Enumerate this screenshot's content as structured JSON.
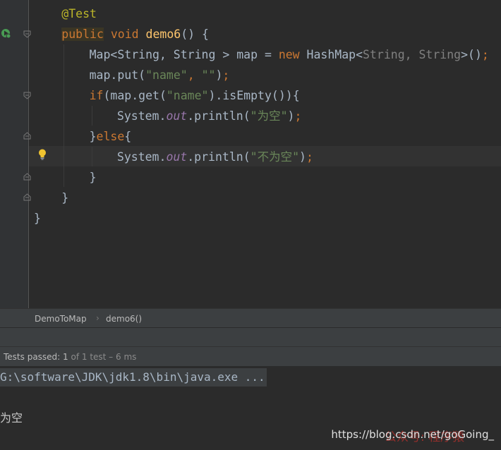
{
  "editor": {
    "code_lines": [
      {
        "indent": 10,
        "tokens": [
          {
            "t": "@Test",
            "c": "ann"
          }
        ]
      },
      {
        "indent": 10,
        "tokens": [
          {
            "t": "public",
            "c": "kw-hl"
          },
          {
            "t": " ",
            "c": ""
          },
          {
            "t": "void",
            "c": "kw"
          },
          {
            "t": " ",
            "c": ""
          },
          {
            "t": "demo6",
            "c": "fn"
          },
          {
            "t": "() {",
            "c": ""
          }
        ]
      },
      {
        "indent": 20,
        "tokens": [
          {
            "t": "Map<String, String > map = ",
            "c": ""
          },
          {
            "t": "new",
            "c": "kw"
          },
          {
            "t": " HashMap<",
            "c": ""
          },
          {
            "t": "String, String",
            "c": "gen"
          },
          {
            "t": ">()",
            "c": ""
          },
          {
            "t": ";",
            "c": "kw"
          }
        ]
      },
      {
        "indent": 20,
        "tokens": [
          {
            "t": "map.put(",
            "c": ""
          },
          {
            "t": "\"name\"",
            "c": "str"
          },
          {
            "t": ", ",
            "c": "kw"
          },
          {
            "t": "\"\"",
            "c": "str"
          },
          {
            "t": ")",
            "c": ""
          },
          {
            "t": ";",
            "c": "kw"
          }
        ]
      },
      {
        "indent": 20,
        "tokens": [
          {
            "t": "if",
            "c": "kw"
          },
          {
            "t": "(map.get(",
            "c": ""
          },
          {
            "t": "\"name\"",
            "c": "str"
          },
          {
            "t": ").isEmpty()){",
            "c": ""
          }
        ]
      },
      {
        "indent": 30,
        "tokens": [
          {
            "t": "System.",
            "c": ""
          },
          {
            "t": "out",
            "c": "field"
          },
          {
            "t": ".println(",
            "c": ""
          },
          {
            "t": "\"为空\"",
            "c": "str"
          },
          {
            "t": ")",
            "c": ""
          },
          {
            "t": ";",
            "c": "kw"
          }
        ]
      },
      {
        "indent": 20,
        "tokens": [
          {
            "t": "}",
            "c": ""
          },
          {
            "t": "else",
            "c": "kw"
          },
          {
            "t": "{",
            "c": ""
          }
        ]
      },
      {
        "indent": 30,
        "tokens": [
          {
            "t": "System.",
            "c": ""
          },
          {
            "t": "out",
            "c": "field"
          },
          {
            "t": ".println(",
            "c": ""
          },
          {
            "t": "\"不为空\"",
            "c": "str"
          },
          {
            "t": ")",
            "c": ""
          },
          {
            "t": ";",
            "c": "kw"
          }
        ]
      },
      {
        "indent": 20,
        "tokens": [
          {
            "t": "}",
            "c": ""
          }
        ]
      },
      {
        "indent": 10,
        "tokens": [
          {
            "t": "}",
            "c": ""
          }
        ]
      },
      {
        "indent": 0,
        "tokens": [
          {
            "t": "}",
            "c": ""
          }
        ]
      }
    ],
    "current_line": 8,
    "icons": {
      "run": "run-test-icon",
      "intention": "lightbulb-icon",
      "fold": "fold-marker-icon"
    }
  },
  "breadcrumb": {
    "items": [
      "DemoToMap",
      "demo6()"
    ],
    "separator": "›"
  },
  "run_panel": {
    "status_prefix": "Tests passed: ",
    "passed_count": "1",
    "status_suffix": " of 1 test – 6 ms",
    "command_line": "G:\\software\\JDK\\jdk1.8\\bin\\java.exe ...",
    "output_line": "为空"
  },
  "watermark": {
    "text": "https://blog.csdn.net/goGoing_",
    "overlay_text": "公众号: 程序猿"
  },
  "colors": {
    "keyword": "#cc7832",
    "function": "#ffc66d",
    "string": "#6a8759",
    "field": "#9876aa",
    "annotation": "#bbb529",
    "text": "#a9b7c6",
    "background": "#2b2b2b",
    "gutter": "#313335"
  }
}
